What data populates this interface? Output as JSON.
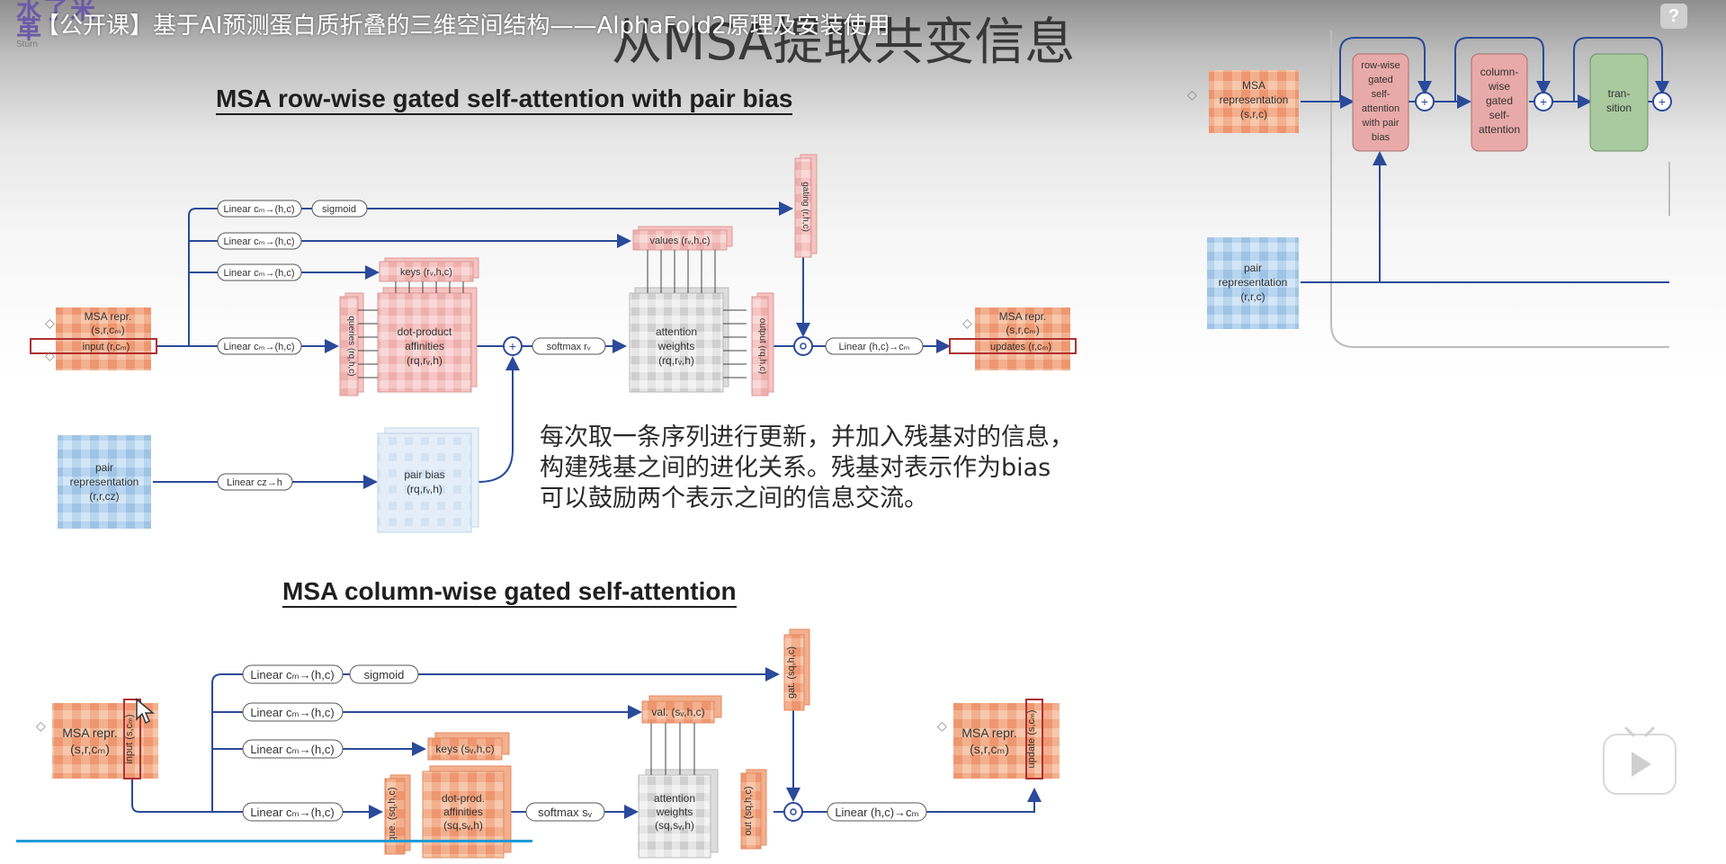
{
  "video": {
    "title": "【公开课】基于AI预测蛋白质折叠的三维空间结构——AlphaFold2原理及安装使用",
    "help_label": "?"
  },
  "logo": {
    "glyphs": "水了米革",
    "sub": "Sturn"
  },
  "slide": {
    "title": "从MSA提取共变信息",
    "section1_title": "MSA row-wise gated self-attention with pair bias",
    "section2_title": "MSA column-wise gated self-attention",
    "note_lines": [
      "每次取一条序列进行更新，并加入残基对的信息，",
      "构建残基之间的进化关系。残基对表示作为bias",
      "可以鼓励两个表示之间的信息交流。"
    ]
  },
  "row_diagram": {
    "msa_repr": [
      "MSA repr.",
      "(s,r,cₘ)"
    ],
    "input_label": "input (r,cₘ)",
    "linears": [
      "Linear cₘ→(h,c)",
      "Linear cₘ→(h,c)",
      "Linear cₘ→(h,c)",
      "Linear cₘ→(h,c)"
    ],
    "sigmoid": "sigmoid",
    "gating": "gating (r,h,c)",
    "values": "values (rᵥ,h,c)",
    "keys": "keys (rᵥ,h,c)",
    "queries": "queries (rq,h,c)",
    "dot_product": [
      "dot-product",
      "affinities",
      "(rq,rᵥ,h)"
    ],
    "softmax": "softmax rᵥ",
    "attention_weights": [
      "attention",
      "weights",
      "(rq,rᵥ,h)"
    ],
    "output": "output (rq,h,c)",
    "linear_out": "Linear (h,c)→cₘ",
    "msa_out": [
      "MSA repr.",
      "(s,r,cₘ)"
    ],
    "updates_label": "updates (r,cₘ)",
    "pair_repr": [
      "pair",
      "representation",
      "(r,r,cz)"
    ],
    "linear_pair": "Linear cz→h",
    "pair_bias": [
      "pair bias",
      "(rq,rᵥ,h)"
    ]
  },
  "col_diagram": {
    "msa_repr": [
      "MSA repr.",
      "(s,r,cₘ)"
    ],
    "input_label": "input (s,cₘ)",
    "linears": [
      "Linear cₘ→(h,c)",
      "Linear cₘ→(h,c)",
      "Linear cₘ→(h,c)",
      "Linear cₘ→(h,c)"
    ],
    "sigmoid": "sigmoid",
    "gat": "gat. (sq,h,c)",
    "val": "val. (sᵥ,h,c)",
    "keys": "keys (sᵥ,h,c)",
    "que": "que. (sq,h,c)",
    "dot_prod": [
      "dot-prod.",
      "affinities",
      "(sq,sᵥ,h)"
    ],
    "softmax": "softmax sᵥ",
    "attention_weights": [
      "attention",
      "weights",
      "(sq,sᵥ,h)"
    ],
    "out": "out (sq,h,c)",
    "linear_out": "Linear (h,c)→cₘ",
    "msa_out": [
      "MSA repr.",
      "(s,r,cₘ)"
    ],
    "update_label": "update (s,cₘ)"
  },
  "evoformer": {
    "msa_repr": [
      "MSA",
      "representation",
      "(s,r,c)"
    ],
    "row_block": [
      "row-wise",
      "gated",
      "self-",
      "attention",
      "with pair",
      "bias"
    ],
    "col_block": [
      "column-",
      "wise",
      "gated",
      "self-",
      "attention"
    ],
    "transition": [
      "tran-",
      "sition"
    ],
    "pair_repr": [
      "pair",
      "representation",
      "(r,r,c)"
    ]
  },
  "colors": {
    "accent_line": "#2a4a9a",
    "msa_orange": "#f0a27c",
    "pair_blue": "#a9cbe8",
    "evo_pink": "#e8aaa8",
    "evo_green": "#a9c99f",
    "progress": "#1e9bd7"
  }
}
